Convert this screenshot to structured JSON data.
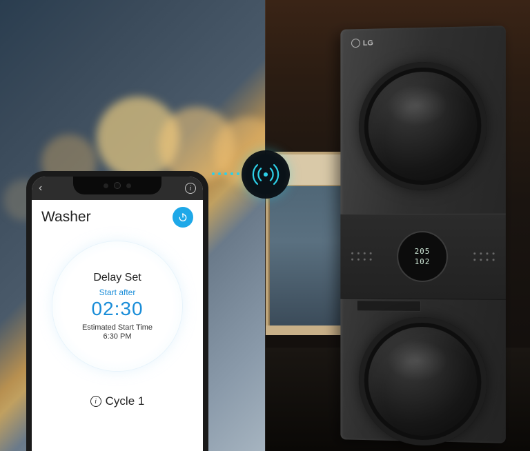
{
  "phone": {
    "app_title": "Washer",
    "delay_set_label": "Delay Set",
    "start_after_label": "Start after",
    "delay_time": "02:30",
    "est_label": "Estimated Start Time",
    "est_time": "6:30 PM",
    "cycle_label": "Cycle 1"
  },
  "appliance": {
    "brand": "LG",
    "display_top": "205",
    "display_bot": "102"
  },
  "colors": {
    "accent_blue": "#1ea8e8",
    "cyan_glow": "#2dd0e8"
  }
}
